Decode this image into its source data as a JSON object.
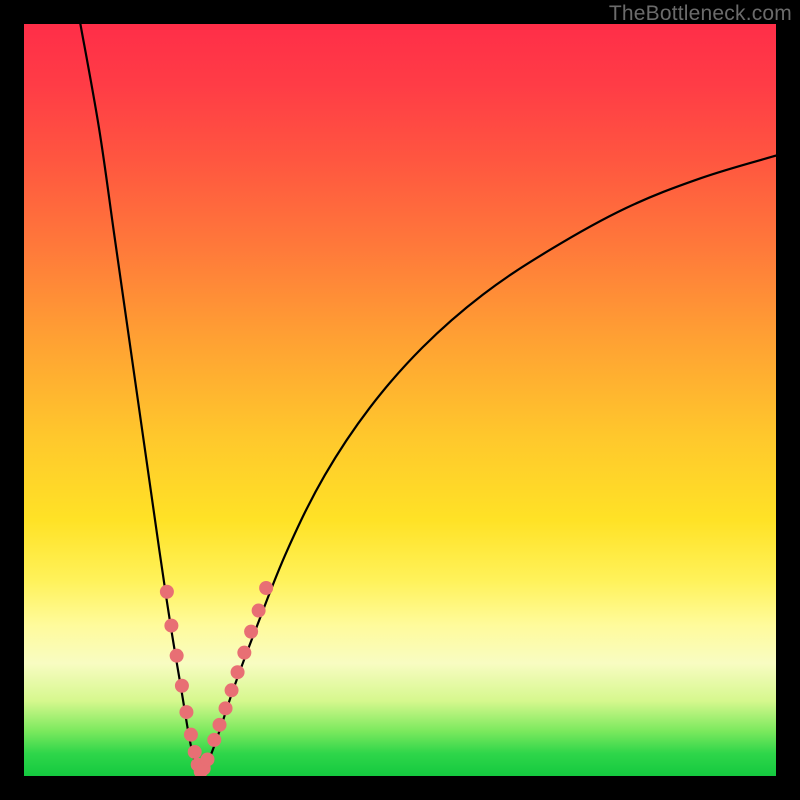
{
  "watermark": "TheBottleneck.com",
  "colors": {
    "frame": "#000000",
    "curve_stroke": "#000000",
    "dot_fill": "#e86f74",
    "gradient_top": "#ff2e48",
    "gradient_bottom": "#14c93f"
  },
  "chart_data": {
    "type": "line",
    "title": "",
    "xlabel": "",
    "ylabel": "",
    "xlim": [
      0,
      100
    ],
    "ylim": [
      0,
      100
    ],
    "description": "V-shaped bottleneck curve on a red-to-green heat gradient. The curve descends steeply from the top-left, reaches a minimum near x≈23, y≈0, then rises with a concave shape toward the upper right. Pink dots are overlaid on both flanks of the V in the lower-yellow region.",
    "series": [
      {
        "name": "left-branch",
        "x": [
          7.5,
          10,
          12,
          14,
          16,
          18,
          19.5,
          21,
          22,
          22.8,
          23.3
        ],
        "y": [
          100,
          86,
          72,
          58,
          44,
          30,
          20,
          11,
          5,
          1.5,
          0.3
        ]
      },
      {
        "name": "right-branch",
        "x": [
          23.3,
          24.5,
          26,
          28,
          31,
          35,
          40,
          46,
          53,
          61,
          70,
          80,
          90,
          100
        ],
        "y": [
          0.3,
          2,
          6,
          12,
          20,
          30,
          40,
          49,
          57,
          64,
          70,
          75.5,
          79.5,
          82.5
        ]
      }
    ],
    "dots": {
      "name": "sample-points",
      "x": [
        19.0,
        19.6,
        20.3,
        21.0,
        21.6,
        22.2,
        22.7,
        23.1,
        23.5,
        23.9,
        24.4,
        25.3,
        26.0,
        26.8,
        27.6,
        28.4,
        29.3,
        30.2,
        31.2,
        32.2
      ],
      "y": [
        24.5,
        20.0,
        16.0,
        12.0,
        8.5,
        5.5,
        3.2,
        1.5,
        0.6,
        1.0,
        2.2,
        4.8,
        6.8,
        9.0,
        11.4,
        13.8,
        16.4,
        19.2,
        22.0,
        25.0
      ]
    }
  }
}
